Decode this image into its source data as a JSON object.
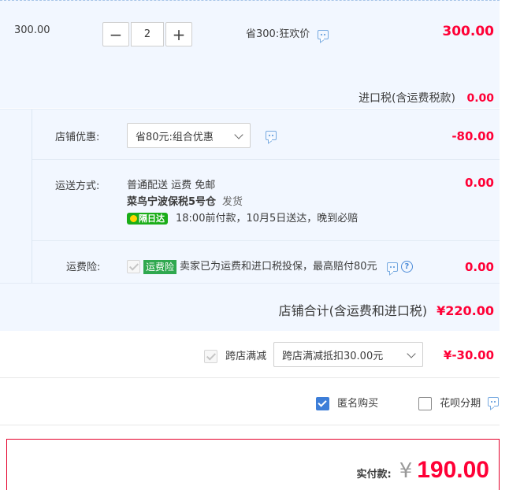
{
  "item": {
    "unit_price": "300.00",
    "quantity": "2",
    "promo_text": "省300:狂欢价",
    "subtotal": "300.00",
    "tax_label": "进口税(含运费税款)",
    "tax_amount": "0.00"
  },
  "shop": {
    "discount_label": "店铺优惠:",
    "discount_select": "省80元:组合优惠",
    "discount_amount": "-80.00",
    "shipping_label": "运送方式:",
    "shipping_line1": "普通配送 运费 免邮",
    "warehouse": "菜鸟宁波保税5号仓",
    "ship_note": "发货",
    "next_day_badge": "隔日达",
    "delivery_promise": "18:00前付款，10月5日送达，晚到必赔",
    "shipping_amount": "0.00",
    "insurance_label": "运费险:",
    "insurance_badge": "运费险",
    "insurance_text": "卖家已为运费和进口税投保，最高赔付80元",
    "insurance_amount": "0.00",
    "total_label": "店铺合计(含运费和进口税)",
    "total_amount": "¥220.00"
  },
  "cross_store": {
    "label": "跨店满减",
    "select": "跨店满减抵扣30.00元",
    "amount": "¥-30.00"
  },
  "options": {
    "anonymous": "匿名购买",
    "installment": "花呗分期"
  },
  "payment": {
    "label": "实付款:",
    "currency": "¥",
    "amount": "190.00"
  }
}
